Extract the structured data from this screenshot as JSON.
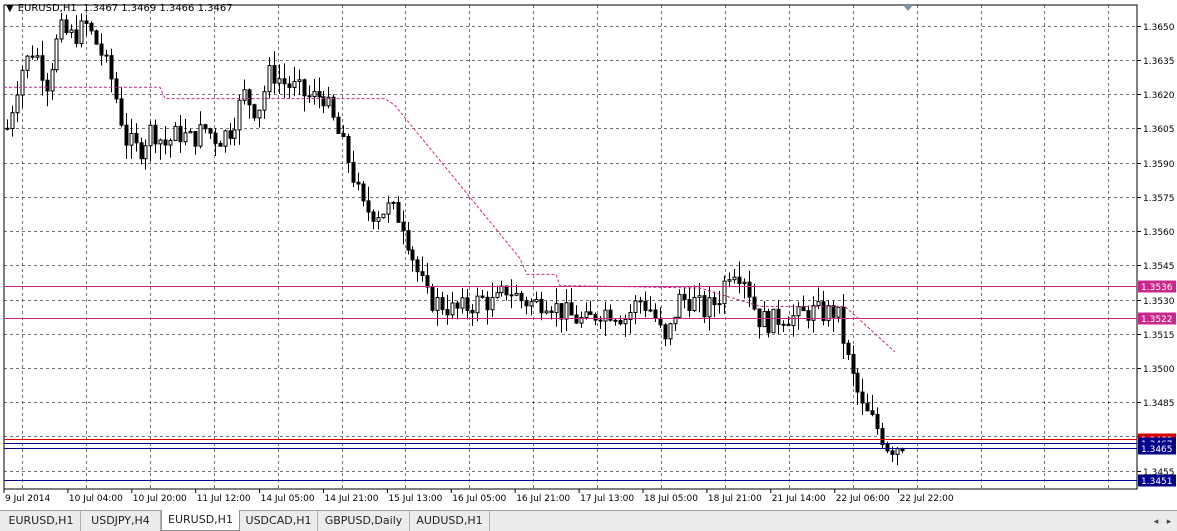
{
  "header": {
    "symbol_tf": "EURUSD,H1",
    "ohlc": "1.3467 1.3469 1.3466 1.3467"
  },
  "tabs": [
    {
      "label": "EURUSD,H1",
      "active": false
    },
    {
      "label": "USDJPY,H4",
      "active": false
    },
    {
      "label": "EURUSD,H1",
      "active": true
    },
    {
      "label": "USDCAD,H1",
      "active": false
    },
    {
      "label": "GBPUSD,Daily",
      "active": false
    },
    {
      "label": "AUDUSD,H1",
      "active": false
    }
  ],
  "colors": {
    "grid": "#000000",
    "candle": "#000000",
    "magenta": "#c8288c",
    "red": "#d00000",
    "blue": "#00008b"
  },
  "chart_data": {
    "type": "candlestick",
    "symbol": "EURUSD",
    "timeframe": "H1",
    "ylim": [
      1.3447,
      1.3659
    ],
    "ytick_labels": [
      "1.3650",
      "1.3635",
      "1.3620",
      "1.3605",
      "1.3590",
      "1.3575",
      "1.3560",
      "1.3545",
      "1.3530",
      "1.3515",
      "1.3500",
      "1.3485",
      "1.3470",
      "1.3455"
    ],
    "xtick_labels": [
      "9 Jul 2014",
      "10 Jul 04:00",
      "10 Jul 20:00",
      "11 Jul 12:00",
      "14 Jul 05:00",
      "14 Jul 21:00",
      "15 Jul 13:00",
      "16 Jul 05:00",
      "16 Jul 21:00",
      "17 Jul 13:00",
      "18 Jul 05:00",
      "18 Jul 21:00",
      "21 Jul 14:00",
      "22 Jul 06:00",
      "22 Jul 22:00"
    ],
    "grid": true,
    "horizontal_lines": [
      {
        "price": 1.3536,
        "label": "1.3536",
        "color": "magenta"
      },
      {
        "price": 1.3522,
        "label": "1.3522",
        "color": "magenta"
      },
      {
        "price": 1.3469,
        "label": "1.3469",
        "color": "red"
      },
      {
        "price": 1.3467,
        "label": "1.3467",
        "color": "blue"
      },
      {
        "price": 1.3465,
        "label": "1.3465",
        "color": "blue"
      },
      {
        "price": 1.3451,
        "label": "1.3451",
        "color": "blue"
      }
    ],
    "close_path": [
      1.3605,
      1.363,
      1.364,
      1.3625,
      1.3648,
      1.3645,
      1.365,
      1.364,
      1.3625,
      1.36,
      1.3595,
      1.3605,
      1.3598,
      1.3603,
      1.36,
      1.3605,
      1.36,
      1.3605,
      1.362,
      1.3612,
      1.363,
      1.3625,
      1.3622,
      1.3618,
      1.362,
      1.3605,
      1.359,
      1.357,
      1.3568,
      1.357,
      1.3565,
      1.3545,
      1.353,
      1.3528,
      1.3525,
      1.3527,
      1.353,
      1.3528,
      1.3535,
      1.353,
      1.3528,
      1.353,
      1.3525,
      1.3522,
      1.352,
      1.3525,
      1.3525,
      1.3522,
      1.353,
      1.3525,
      1.351,
      1.353,
      1.353,
      1.3525,
      1.353,
      1.3545,
      1.354,
      1.3522,
      1.352,
      1.3523,
      1.3522,
      1.3525,
      1.3524,
      1.3525,
      1.35,
      1.3482,
      1.3475,
      1.3465,
      1.3467
    ]
  }
}
